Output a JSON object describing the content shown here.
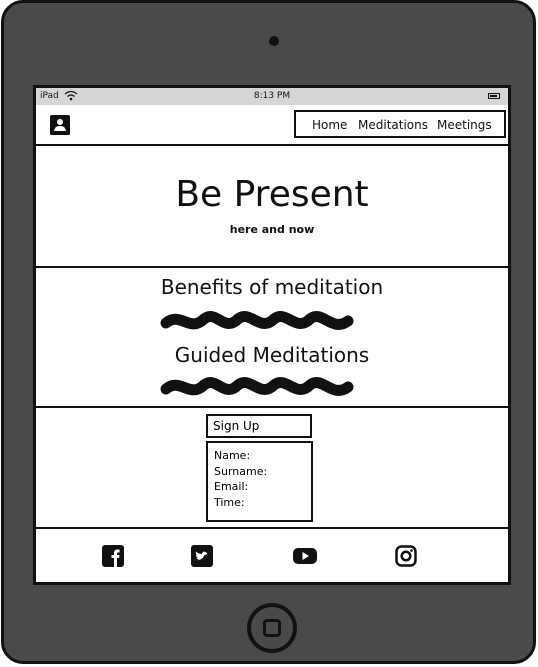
{
  "status": {
    "carrier": "iPad",
    "time": "8:13 PM"
  },
  "nav": {
    "items": [
      "Home",
      "Meditations",
      "Meetings"
    ]
  },
  "hero": {
    "title": "Be Present",
    "subtitle": "here and now"
  },
  "sections": {
    "benefits_title": "Benefits of meditation",
    "guided_title": "Guided Meditations"
  },
  "signup": {
    "button_label": "Sign Up",
    "fields": [
      "Name:",
      "Surname:",
      "Email:",
      "Time:"
    ]
  },
  "footer": {
    "icons": [
      "facebook-icon",
      "twitter-icon",
      "youtube-icon",
      "instagram-icon"
    ]
  },
  "colors": {
    "frame": "#4a4a4a",
    "ink": "#111111",
    "statusbar": "#d6d6d6"
  }
}
